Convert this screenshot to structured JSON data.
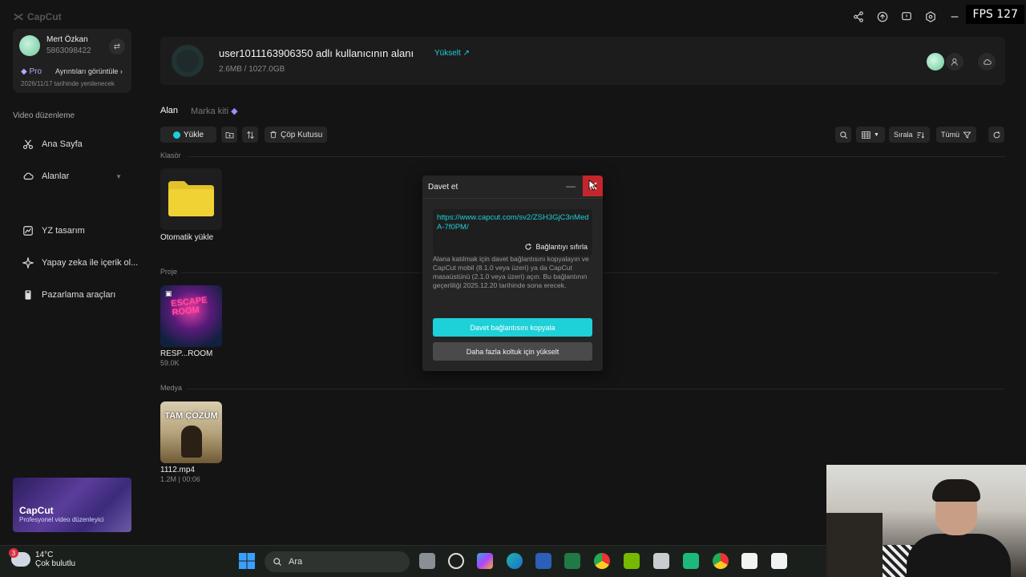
{
  "app": {
    "logo_text": "CapCut"
  },
  "fps": "FPS 127",
  "user": {
    "name": "Mert Özkan",
    "id": "5863098422",
    "plan": "Pro",
    "details_label": "Ayrıntıları görüntüle",
    "renew_text": "2026/11/17 tarihinde yenilenecek"
  },
  "sidebar": {
    "section_title": "Video düzenleme",
    "items": [
      {
        "label": "Ana Sayfa",
        "icon": "scissors-icon"
      },
      {
        "label": "Alanlar",
        "icon": "cloud-icon"
      },
      {
        "label": "YZ tasarım",
        "icon": "ai-design-icon"
      },
      {
        "label": "Yapay zeka ile içerik ol...",
        "icon": "sparkle-icon"
      },
      {
        "label": "Pazarlama araçları",
        "icon": "marketing-icon"
      }
    ],
    "promo": {
      "title": "CapCut",
      "subtitle": "Profesyonel video düzenleyici"
    }
  },
  "space": {
    "name": "user1011163906350 adlı kullanıcının alanı",
    "upgrade_label": "Yükselt ↗",
    "storage": "2.6MB / 1027.0GB"
  },
  "tabs": [
    {
      "label": "Alan"
    },
    {
      "label": "Marka kiti"
    }
  ],
  "toolbar": {
    "upload_label": "Yükle",
    "trash_label": "Çöp Kutusu",
    "sort_label": "Sırala",
    "filter_label": "Tümü"
  },
  "sections": {
    "folder": "Klasör",
    "project": "Proje",
    "media": "Medya"
  },
  "folder_item": {
    "name": "Otomatik yükle"
  },
  "project_item": {
    "name": "RESP...ROOM",
    "size": "59.0K"
  },
  "media_item": {
    "name": "1112.mp4",
    "meta": "1.2M | 00:06",
    "thumb_caption": "TAM ÇÖZÜM"
  },
  "dialog": {
    "title": "Davet et",
    "link": "https://www.capcut.com/sv2/ZSH3GjC3nMedA-7f0PM/",
    "reset_label": "Bağlantıyı sıfırla",
    "description": "Alana katılmak için davet bağlantısını kopyalayın ve CapCut mobil (8.1.0 veya üzeri) ya da CapCut masaüstünü (2.1.0 veya üzeri) açın. Bu bağlantının geçerliliği 2025.12.20 tarihinde sona erecek.",
    "copy_button": "Davet bağlantısını kopyala",
    "upgrade_button": "Daha fazla koltuk için yükselt"
  },
  "taskbar": {
    "weather_badge": "3",
    "temperature": "14°C",
    "weather_desc": "Çok bulutlu",
    "search_placeholder": "Ara"
  },
  "colors": {
    "accent": "#1ed0d8",
    "close_red": "#c4262b"
  }
}
